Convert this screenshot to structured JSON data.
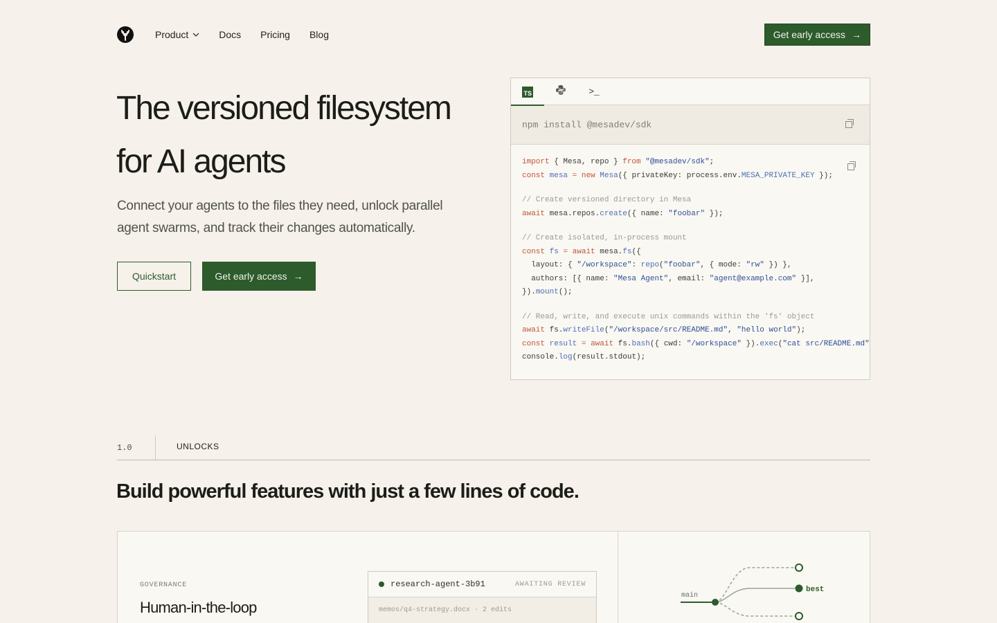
{
  "nav": {
    "logo": "mesa-logo",
    "links": [
      {
        "label": "Product",
        "has_dropdown": true
      },
      {
        "label": "Docs"
      },
      {
        "label": "Pricing"
      },
      {
        "label": "Blog"
      }
    ],
    "cta_label": "Get early access",
    "cta_arrow": "→"
  },
  "hero": {
    "title_line1": "The versioned filesystem",
    "title_line2": "for AI agents",
    "subtitle": "Connect your agents to the files they need, unlock parallel agent swarms, and track their changes automatically.",
    "btn_quickstart": "Quickstart",
    "btn_access": "Get early access",
    "btn_arrow": "→"
  },
  "code_panel": {
    "tabs": [
      {
        "name": "typescript",
        "icon": "TS",
        "active": true
      },
      {
        "name": "python",
        "icon": "python-icon",
        "active": false
      },
      {
        "name": "cli",
        "icon": ">_",
        "active": false
      }
    ],
    "install_cmd": "npm install @mesadev/sdk"
  },
  "section": {
    "number": "1.0",
    "label": "UNLOCKS",
    "title": "Build powerful features with just a few lines of code."
  },
  "card_governance": {
    "kicker": "GOVERNANCE",
    "title": "Human-in-the-loop",
    "review": {
      "agent": "research-agent-3b91",
      "status": "AWAITING REVIEW",
      "file": "memos/q4-strategy.docx · 2 edits"
    }
  },
  "card_branches": {
    "main_label": "main",
    "best_label": "best"
  },
  "colors": {
    "accent": "#2d5b2c",
    "background": "#f6f1ea",
    "keyword": "#c0543b",
    "function": "#4d6fb6"
  }
}
